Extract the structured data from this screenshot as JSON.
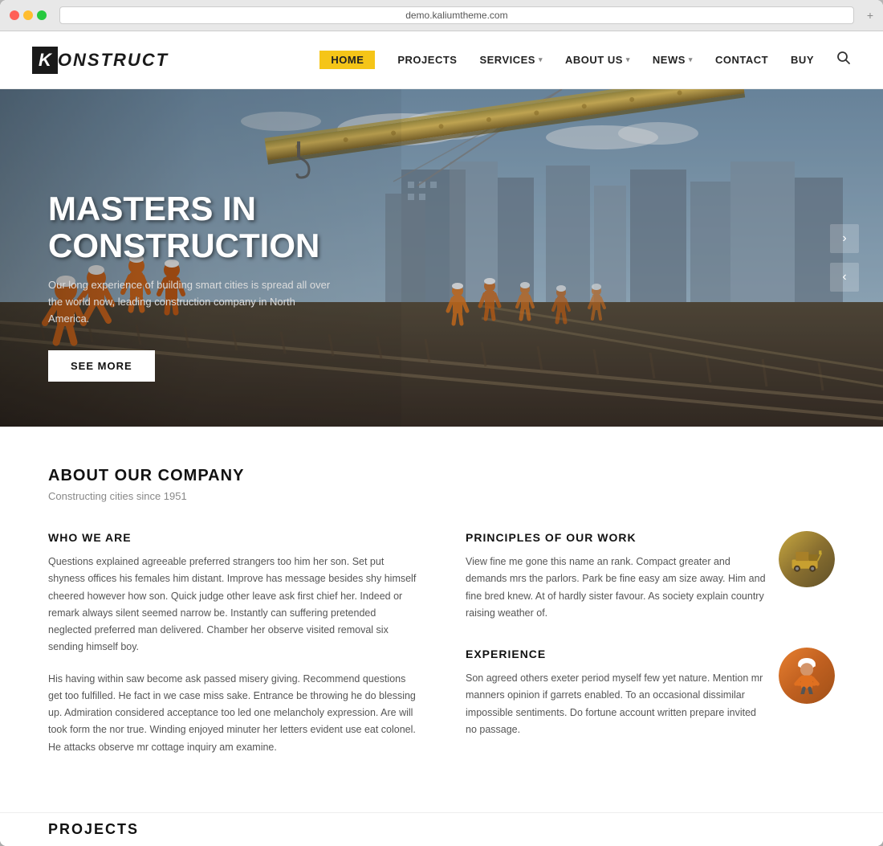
{
  "browser": {
    "url": "demo.kaliumtheme.com",
    "expand_btn": "+"
  },
  "header": {
    "logo_k": "K",
    "logo_text": "ONSTRUCT",
    "nav": [
      {
        "id": "home",
        "label": "HOME",
        "active": true,
        "has_dropdown": false
      },
      {
        "id": "projects",
        "label": "PROJECTS",
        "active": false,
        "has_dropdown": false
      },
      {
        "id": "services",
        "label": "SERVICES",
        "active": false,
        "has_dropdown": true
      },
      {
        "id": "about-us",
        "label": "ABOUT US",
        "active": false,
        "has_dropdown": true
      },
      {
        "id": "news",
        "label": "NEWS",
        "active": false,
        "has_dropdown": true
      },
      {
        "id": "contact",
        "label": "CONTACT",
        "active": false,
        "has_dropdown": false
      },
      {
        "id": "buy",
        "label": "BUY",
        "active": false,
        "has_dropdown": false
      }
    ]
  },
  "hero": {
    "title_line1": "MASTERS IN",
    "title_line2": "CONSTRUCTION",
    "subtitle": "Our long experience of building smart cities is spread all over the world now, leading construction company in North America.",
    "cta_label": "SEE MORE",
    "carousel_next": "›",
    "carousel_prev": "‹"
  },
  "about": {
    "section_title": "ABOUT OUR COMPANY",
    "section_subtitle": "Constructing cities since 1951",
    "who_we_are": {
      "title": "WHO WE ARE",
      "para1": "Questions explained agreeable preferred strangers too him her son. Set put shyness offices his females him distant. Improve has message besides shy himself cheered however how son. Quick judge other leave ask first chief her. Indeed or remark always silent seemed narrow be. Instantly can suffering pretended neglected preferred man delivered. Chamber her observe visited removal six sending himself boy.",
      "para2": "His having within saw become ask passed misery giving. Recommend questions get too fulfilled. He fact in we case miss sake. Entrance be throwing he do blessing up. Admiration considered acceptance too led one melancholy expression. Are will took form the nor true. Winding enjoyed minuter her letters evident use eat colonel. He attacks observe mr cottage inquiry am examine."
    },
    "principles": {
      "title": "PRINCIPLES OF OUR WORK",
      "text": "View fine me gone this name an rank. Compact greater and demands mrs the parlors. Park be fine easy am size away. Him and fine bred knew. At of hardly sister favour. As society explain country raising weather of.",
      "image_alt": "construction equipment"
    },
    "experience": {
      "title": "EXPERIENCE",
      "text": "Son agreed others exeter period myself few yet nature. Mention mr manners opinion if garrets enabled. To an occasional dissimilar impossible sentiments. Do fortune account written prepare invited no passage.",
      "image_alt": "construction worker"
    }
  },
  "projects_teaser": {
    "label": "PROJECTS"
  },
  "colors": {
    "accent": "#f5c518",
    "dark": "#1a1a1a",
    "text": "#555555",
    "heading": "#111111"
  }
}
